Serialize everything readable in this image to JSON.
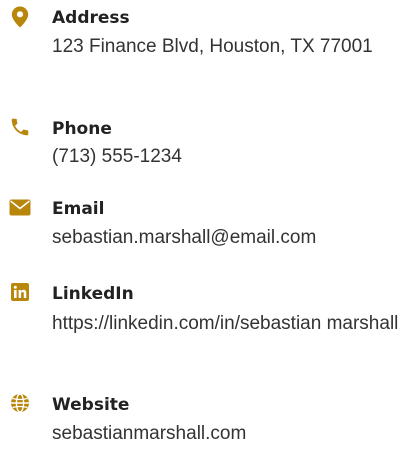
{
  "colors": {
    "accent": "#b8860b",
    "label_text": "#222222",
    "value_text": "#333333",
    "background": "#ffffff"
  },
  "contact": {
    "address": {
      "icon": "map-pin-icon",
      "label": "Address",
      "value": "123 Finance Blvd, Houston, TX 77001"
    },
    "phone": {
      "icon": "phone-icon",
      "label": "Phone",
      "value": "(713) 555-1234"
    },
    "email": {
      "icon": "envelope-icon",
      "label": "Email",
      "value": "sebastian.marshall@email.com"
    },
    "linkedin": {
      "icon": "linkedin-icon",
      "label": "LinkedIn",
      "value": "https://linkedin.com/in/sebastian marshall"
    },
    "website": {
      "icon": "globe-icon",
      "label": "Website",
      "value": "sebastianmarshall.com"
    }
  }
}
